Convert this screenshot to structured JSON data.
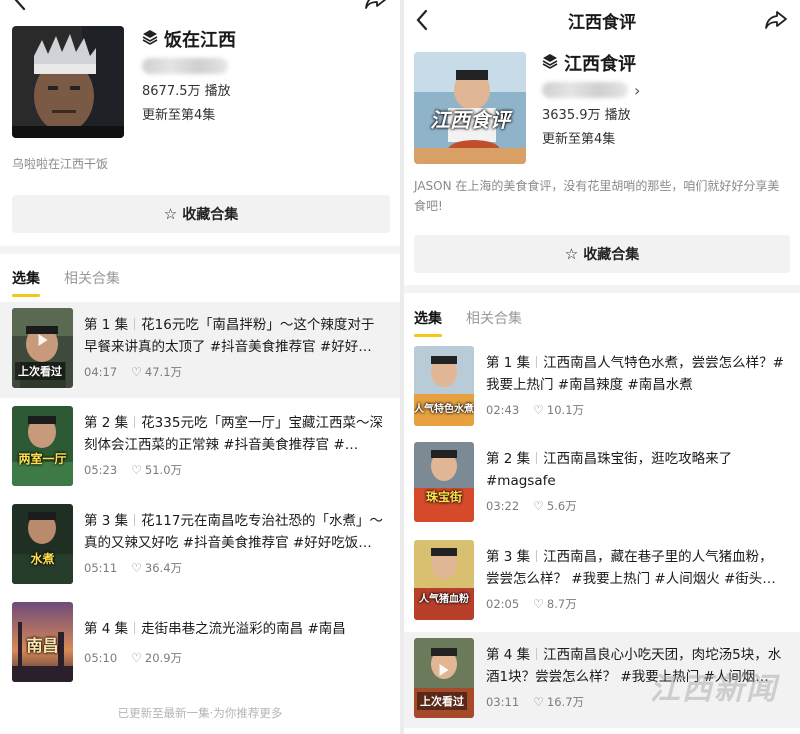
{
  "left": {
    "header": {
      "collection_name": "饭在江西",
      "play_count": "8677.5万 播放",
      "update_status": "更新至第4集",
      "description": "乌啦啦在江西干饭"
    },
    "favorite_button": "收藏合集",
    "tabs": [
      "选集",
      "相关合集"
    ],
    "episodes": [
      {
        "number": "第 1 集",
        "title": "花16元吃「南昌拌粉」～这个辣度对于早餐来讲真的太顶了 #抖音美食推荐官 #好好…",
        "duration": "04:17",
        "likes": "47.1万",
        "thumb_label": "上次看过",
        "highlight": true
      },
      {
        "number": "第 2 集",
        "title": "花335元吃「两室一厅」宝藏江西菜～深刻体会江西菜的正常辣 #抖音美食推荐官 #…",
        "duration": "05:23",
        "likes": "51.0万",
        "thumb_label": "两室一厅",
        "highlight": false
      },
      {
        "number": "第 3 集",
        "title": "花117元在南昌吃专治社恐的「水煮」～真的又辣又好吃 #抖音美食推荐官 #好好吃饭…",
        "duration": "05:11",
        "likes": "36.4万",
        "thumb_label": "水煮",
        "highlight": false
      },
      {
        "number": "第 4 集",
        "title": "走街串巷之流光溢彩的南昌 #南昌",
        "duration": "05:10",
        "likes": "20.9万",
        "thumb_label": "南昌",
        "highlight": false
      }
    ],
    "footer_note": "已更新至最新一集·为你推荐更多"
  },
  "right": {
    "nav_title": "江西食评",
    "header": {
      "collection_name": "江西食评",
      "cover_label": "江西食评",
      "play_count": "3635.9万 播放",
      "update_status": "更新至第4集",
      "description": "JASON 在上海的美食食评，没有花里胡哨的那些，咱们就好好分享美食吧!"
    },
    "favorite_button": "收藏合集",
    "tabs": [
      "选集",
      "相关合集"
    ],
    "episodes": [
      {
        "number": "第 1 集",
        "title": "江西南昌人气特色水煮，尝尝怎么样？#我要上热门 #南昌辣度 #南昌水煮",
        "duration": "02:43",
        "likes": "10.1万",
        "thumb_label": "人气特色水煮",
        "highlight": false
      },
      {
        "number": "第 2 集",
        "title": "江西南昌珠宝街，逛吃攻略来了 #magsafe",
        "duration": "03:22",
        "likes": "5.6万",
        "thumb_label": "珠宝街",
        "highlight": false
      },
      {
        "number": "第 3 集",
        "title": "江西南昌，藏在巷子里的人气猪血粉，尝尝怎么样？ #我要上热门 #人间烟火 #街头…",
        "duration": "02:05",
        "likes": "8.7万",
        "thumb_label": "人气猪血粉",
        "highlight": false
      },
      {
        "number": "第 4 集",
        "title": "江西南昌良心小吃天团，肉坨汤5块，水酒1块？尝尝怎么样？ #我要上热门 #人间烟…",
        "duration": "03:11",
        "likes": "16.7万",
        "thumb_label": "上次看过",
        "highlight": true
      }
    ]
  },
  "watermark": "江西新闻",
  "colors": {
    "accent_underline": "#f5c518",
    "highlight_row": "#f2f2f2",
    "favorite_button_bg": "#f2f2f2"
  }
}
